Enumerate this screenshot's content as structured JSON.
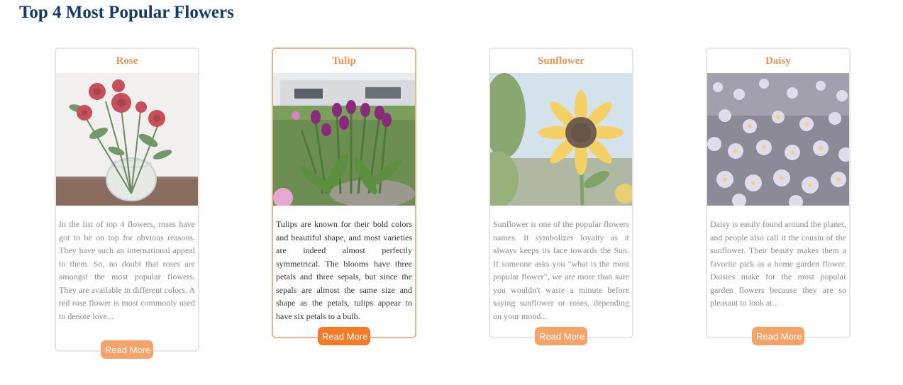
{
  "page": {
    "title": "Top 4 Most Popular Flowers"
  },
  "cards": [
    {
      "title": "Rose",
      "image": "rose-vase-photo",
      "text": "In the list of top 4 flowers, roses have got to be on top for obvious reasons. They have such an international appeal to them. So, no doubt that roses are amongst the most popular flowers. They are available in different colors. A red rose flower is most commonly used to denote love...",
      "button": "Read More"
    },
    {
      "title": "Tulip",
      "image": "tulip-garden-photo",
      "text": "Tulips are known for their bold colors and beautiful shape, and most varieties are indeed almost perfectly symmetrical. The blooms have three petals and three sepals, but since the sepals are almost the same size and shape as the petals, tulips appear to have six petals to a bulb.",
      "button": "Read More"
    },
    {
      "title": "Sunflower",
      "image": "sunflower-photo",
      "text": "Sunflower is one of the popular flowers names. It symbolizes loyalty as it always keeps its face towards the Sun. If someone asks you \"what is the most popular flower\", we are more than sure you wouldn't waste a minute before saying sunflower or roses, depending on your mood...",
      "button": "Read More"
    },
    {
      "title": "Daisy",
      "image": "daisy-field-photo",
      "text": "Daisy is easily found around the planet, and people also call it the cousin of the sunflower. Their beauty makes them a favorite pick as a home garden flower. Daisies make for the most popular garden flowers because they are so pleasant to look at...",
      "button": "Read More"
    }
  ],
  "colors": {
    "title": "#123a6e",
    "card_title": "#f19350",
    "button": "#f6a36a",
    "button_active": "#f47b2a",
    "active_border": "#e9b58d"
  }
}
